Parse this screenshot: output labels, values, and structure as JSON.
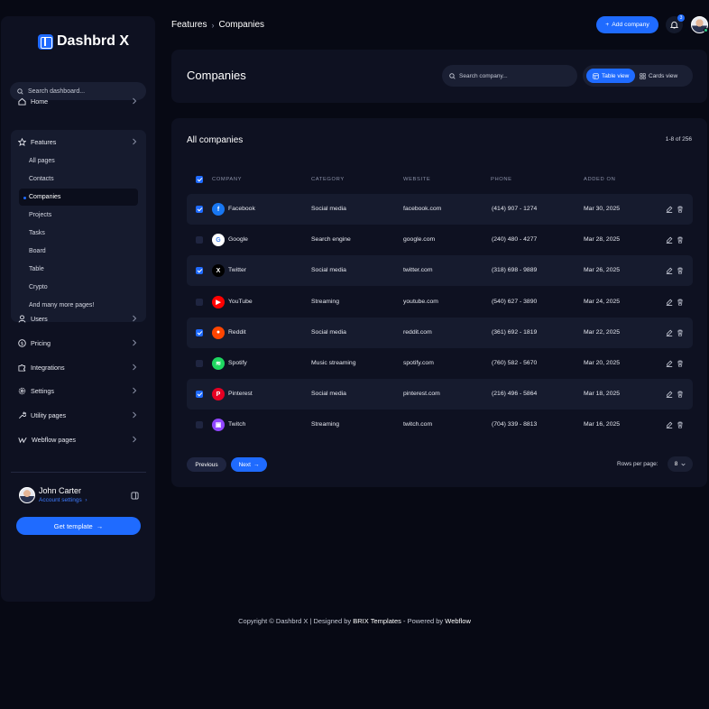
{
  "sidebar": {
    "logo": "Dashbrd X",
    "search_placeholder": "Search dashboard...",
    "items": [
      {
        "label": "Home",
        "icon": "home-icon"
      },
      {
        "label": "Features",
        "icon": "star-icon"
      },
      {
        "label": "Users",
        "icon": "user-icon"
      },
      {
        "label": "Pricing",
        "icon": "dollar-icon"
      },
      {
        "label": "Integrations",
        "icon": "puzzle-icon"
      },
      {
        "label": "Settings",
        "icon": "gear-icon"
      },
      {
        "label": "Utility pages",
        "icon": "wrench-icon"
      },
      {
        "label": "Webflow pages",
        "icon": "webflow-icon"
      }
    ],
    "features_sub": [
      "All pages",
      "Contacts",
      "Companies",
      "Projects",
      "Tasks",
      "Board",
      "Table",
      "Crypto",
      "And many more pages!"
    ],
    "active_sub": "Companies",
    "profile": {
      "name": "John Carter",
      "link": "Account settings"
    },
    "cta": "Get template"
  },
  "header": {
    "breadcrumb": [
      "Features",
      "Companies"
    ],
    "add_button": "Add company",
    "notification_count": "3"
  },
  "page": {
    "title": "Companies",
    "search_placeholder": "Search company...",
    "views": [
      "Table view",
      "Cards view"
    ],
    "active_view": "Table view"
  },
  "table": {
    "title": "All companies",
    "count": "1-8 of 256",
    "columns": [
      "COMPANY",
      "CATEGORY",
      "WEBSITE",
      "PHONE",
      "ADDED ON"
    ],
    "rows": [
      {
        "company": "Facebook",
        "category": "Social media",
        "website": "facebook.com",
        "phone": "(414) 907 - 1274",
        "added": "Mar 30, 2025",
        "checked": true,
        "color": "#1877f2",
        "glyph": "f",
        "icon": "facebook-icon"
      },
      {
        "company": "Google",
        "category": "Search engine",
        "website": "google.com",
        "phone": "(240) 480 - 4277",
        "added": "Mar 28, 2025",
        "checked": false,
        "color": "#ffffff",
        "glyph": "G",
        "icon": "google-icon"
      },
      {
        "company": "Twitter",
        "category": "Social media",
        "website": "twitter.com",
        "phone": "(318) 698 - 9889",
        "added": "Mar 26, 2025",
        "checked": true,
        "color": "#000000",
        "glyph": "X",
        "icon": "x-twitter-icon"
      },
      {
        "company": "YouTube",
        "category": "Streaming",
        "website": "youtube.com",
        "phone": "(540) 627 - 3890",
        "added": "Mar 24, 2025",
        "checked": false,
        "color": "#ff0000",
        "glyph": "▶",
        "icon": "youtube-icon"
      },
      {
        "company": "Reddit",
        "category": "Social media",
        "website": "reddit.com",
        "phone": "(361) 692 - 1819",
        "added": "Mar 22, 2025",
        "checked": true,
        "color": "#ff4500",
        "glyph": "●",
        "icon": "reddit-icon"
      },
      {
        "company": "Spotify",
        "category": "Music streaming",
        "website": "spotify.com",
        "phone": "(760) 582 - 5670",
        "added": "Mar 20, 2025",
        "checked": false,
        "color": "#1ed760",
        "glyph": "≋",
        "icon": "spotify-icon"
      },
      {
        "company": "Pinterest",
        "category": "Social media",
        "website": "pinterest.com",
        "phone": "(216) 496 - 5864",
        "added": "Mar 18, 2025",
        "checked": true,
        "color": "#e60023",
        "glyph": "P",
        "icon": "pinterest-icon"
      },
      {
        "company": "Twitch",
        "category": "Streaming",
        "website": "twitch.com",
        "phone": "(704) 339 - 8813",
        "added": "Mar 16, 2025",
        "checked": false,
        "color": "#9146ff",
        "glyph": "▣",
        "icon": "twitch-icon"
      }
    ],
    "prev": "Previous",
    "next": "Next",
    "rows_label": "Rows per page:",
    "rows_value": "8"
  },
  "footer": {
    "copyright": "Copyright © Dashbrd X | Designed by",
    "brix": "BRIX Templates",
    "powered": "- Powered by",
    "webflow": "Webflow"
  },
  "colors": {
    "accent": "#1f6bff",
    "background": "#070914",
    "card": "#0e1121"
  }
}
